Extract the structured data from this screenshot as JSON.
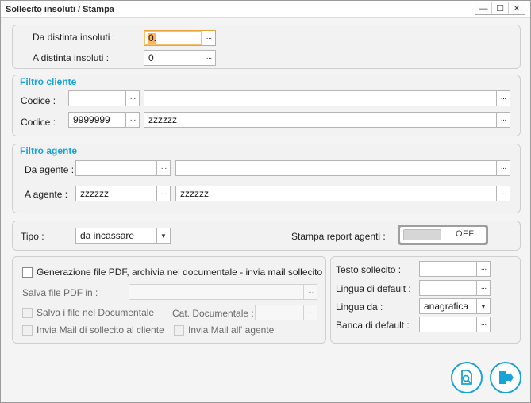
{
  "window": {
    "title": "Sollecito insoluti / Stampa",
    "controls": {
      "minimize": "—",
      "maximize": "☐",
      "close": "✕"
    }
  },
  "distinta": {
    "da_label": "Da distinta insoluti :",
    "da_value": "0.",
    "a_label": "A distinta insoluti :",
    "a_value": "0"
  },
  "filtro_cliente": {
    "title": "Filtro cliente",
    "row1": {
      "label": "Codice :",
      "code": "",
      "name": ""
    },
    "row2": {
      "label": "Codice :",
      "code": "9999999",
      "name": "zzzzzz"
    }
  },
  "filtro_agente": {
    "title": "Filtro agente",
    "da": {
      "label": "Da agente :",
      "code": "",
      "name": ""
    },
    "a": {
      "label": "A agente :",
      "code": "zzzzzz",
      "name": "zzzzzz"
    }
  },
  "tipo": {
    "label": "Tipo :",
    "value": "da incassare",
    "stampa_label": "Stampa report agenti :",
    "toggle_text": "OFF"
  },
  "pdf": {
    "generazione_label": "Generazione file PDF, archivia nel documentale - invia mail sollecito",
    "salva_label": "Salva file PDF in :",
    "salva_value": "",
    "salva_doc_label": "Salva i file nel Documentale",
    "cat_label": "Cat. Documentale :",
    "cat_value": "",
    "invia_cliente_label": "Invia Mail di sollecito al cliente",
    "invia_agente_label": "Invia Mail all' agente"
  },
  "options": {
    "testo_label": "Testo sollecito :",
    "testo_value": "",
    "lingua_default_label": "Lingua di default :",
    "lingua_default_value": "",
    "lingua_da_label": "Lingua da :",
    "lingua_da_value": "anagrafica",
    "banca_label": "Banca di default :",
    "banca_value": ""
  },
  "ellipsis": "···",
  "icons": {
    "preview": "print-preview-icon",
    "exit": "exit-icon"
  },
  "colors": {
    "accent": "#17a3d8",
    "focus": "#e8a33b",
    "highlight": "#ffb35a"
  }
}
